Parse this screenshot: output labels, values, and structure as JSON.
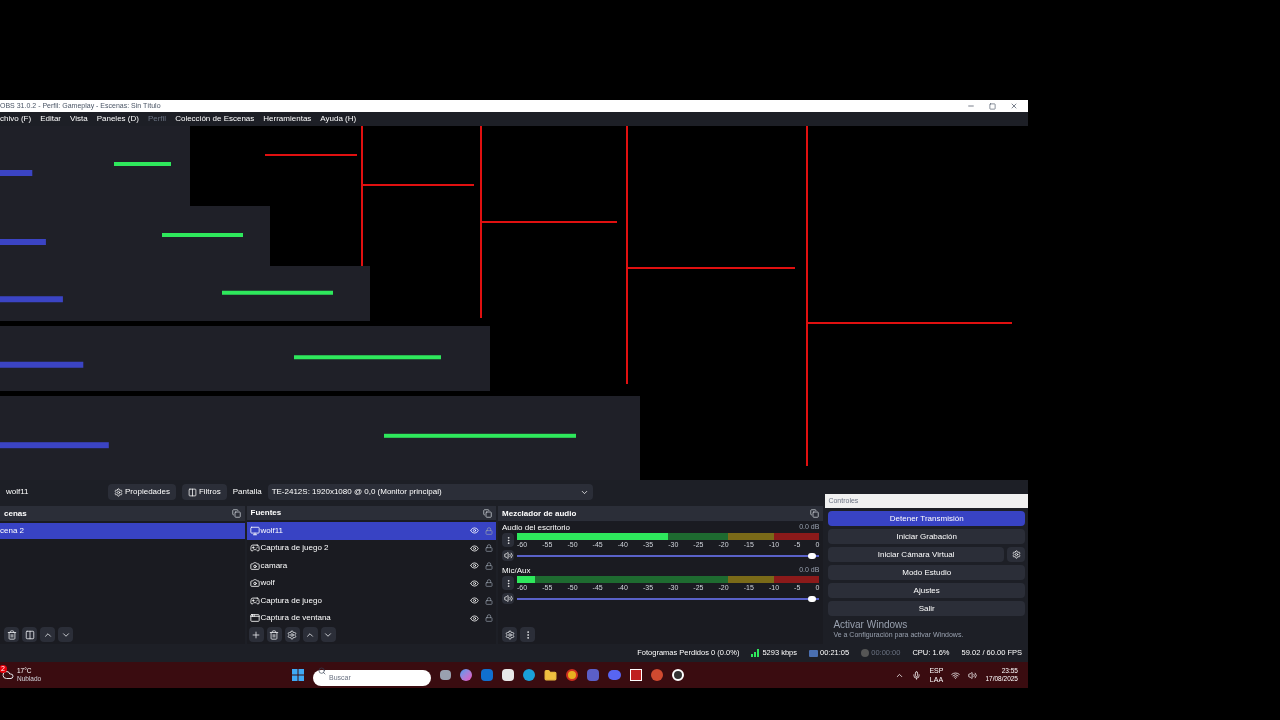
{
  "window": {
    "title": "OBS 31.0.2 - Perfil: Gameplay - Escenas: Sin Título"
  },
  "menu": [
    {
      "label": "chivo (F)",
      "disabled": false
    },
    {
      "label": "Editar",
      "disabled": false
    },
    {
      "label": "Vista",
      "disabled": false
    },
    {
      "label": "Paneles (D)",
      "disabled": false
    },
    {
      "label": "Perfil",
      "disabled": true
    },
    {
      "label": "Colección de Escenas",
      "disabled": false
    },
    {
      "label": "Herramientas",
      "disabled": false
    },
    {
      "label": "Ayuda (H)",
      "disabled": false
    }
  ],
  "source_toolbar": {
    "source": "wolf11",
    "buttons": [
      {
        "label": "Propiedades",
        "kind": "gear"
      },
      {
        "label": "Filtros",
        "kind": "filter"
      }
    ],
    "display_label": "Pantalla",
    "display_value": "TE-2412S: 1920x1080 @ 0,0 (Monitor principal)"
  },
  "scenes": {
    "title": "cenas",
    "items": [
      {
        "label": "cena 2",
        "selected": true
      }
    ]
  },
  "sources": {
    "title": "Fuentes",
    "items": [
      {
        "label": "wolf11",
        "kind": "display",
        "selected": true
      },
      {
        "label": "Captura de juego 2",
        "kind": "game",
        "selected": false
      },
      {
        "label": "camara",
        "kind": "camera",
        "selected": false
      },
      {
        "label": "wolf",
        "kind": "camera",
        "selected": false
      },
      {
        "label": "Captura de juego",
        "kind": "game",
        "selected": false
      },
      {
        "label": "Captura de ventana",
        "kind": "window",
        "selected": false
      }
    ]
  },
  "mixer": {
    "title": "Mezclador de audio",
    "channels": [
      {
        "name": "Audio del escritorio",
        "reading": "0.0 dB",
        "meter": {
          "level": 0.5
        },
        "fader": {
          "level": 0.99
        },
        "scale": [
          "-60",
          "-55",
          "-50",
          "-45",
          "-40",
          "-35",
          "-30",
          "-25",
          "-20",
          "-15",
          "-10",
          "-5",
          "0"
        ]
      },
      {
        "name": "Mic/Aux",
        "reading": "0.0 dB",
        "meter": {
          "level": 0.06
        },
        "fader": {
          "level": 0.99
        },
        "scale": [
          "-60",
          "-55",
          "-50",
          "-45",
          "-40",
          "-35",
          "-30",
          "-25",
          "-20",
          "-15",
          "-10",
          "-5",
          "0"
        ]
      }
    ]
  },
  "controls": {
    "title": "Controles",
    "buttons": [
      {
        "label": "Detener Transmisión",
        "active": true,
        "kind": "plain"
      },
      {
        "label": "Iniciar Grabación",
        "active": false,
        "kind": "plain"
      },
      {
        "label": "Iniciar Cámara Virtual",
        "active": false,
        "kind": "settings"
      },
      {
        "label": "Modo Estudio",
        "active": false,
        "kind": "plain"
      },
      {
        "label": "Ajustes",
        "active": false,
        "kind": "plain"
      },
      {
        "label": "Salir",
        "active": false,
        "kind": "plain"
      }
    ]
  },
  "activation": {
    "title": "Activar Windows",
    "subtitle": "Ve a Configuración para activar Windows."
  },
  "status_bar": {
    "dropped": "Fotogramas Perdidos 0 (0.0%)",
    "bitrate": "5293 kbps",
    "stream_time": "00:21:05",
    "record_time": "00:00:00",
    "cpu": "CPU: 1.6%",
    "fps": "59.02 / 60.00 FPS"
  },
  "taskbar": {
    "weather": {
      "temp": "17°C",
      "condition": "Nublado",
      "badge": "2"
    },
    "search": {
      "placeholder": "Buscar"
    },
    "tray": {
      "language": "ESP",
      "layout": "LAA",
      "time": "23:55",
      "date": "17/08/2025"
    }
  }
}
